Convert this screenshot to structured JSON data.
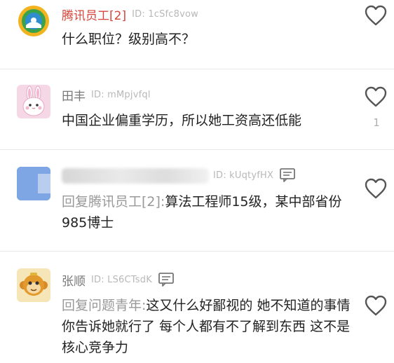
{
  "comments": [
    {
      "user": "腾讯员工[2]",
      "id_text": "ID: 1cSfc8vow",
      "text": "什么职位？级别高不？",
      "avatar": "tencent-news-icon"
    },
    {
      "user": "田丰",
      "id_text": "ID: mMpjvfql",
      "text": "中国企业偏重学历，所以她工资高还低能",
      "avatar": "rabbit-icon",
      "likes": "1"
    },
    {
      "id_text": "ID: kUqtyfHX",
      "reply_prefix": "回复腾讯员工[2]:",
      "text": "算法工程师15级，某中部省份985博士",
      "avatar": "blurred-avatar"
    },
    {
      "user": "张顺",
      "id_text": "ID: LS6CTsdK",
      "reply_prefix": "回复问题青年:",
      "text": "这又什么好鄙视的 她不知道的事情你告诉她就行了 每个人都有不了解到东西 这不是核心竞争力",
      "avatar": "monkey-icon"
    }
  ],
  "icons": {
    "like": "heart-outline-icon",
    "reply": "comment-reply-icon"
  },
  "colors": {
    "level_name": "#d6453b",
    "muted": "#999999",
    "divider": "#e9e9e9"
  }
}
